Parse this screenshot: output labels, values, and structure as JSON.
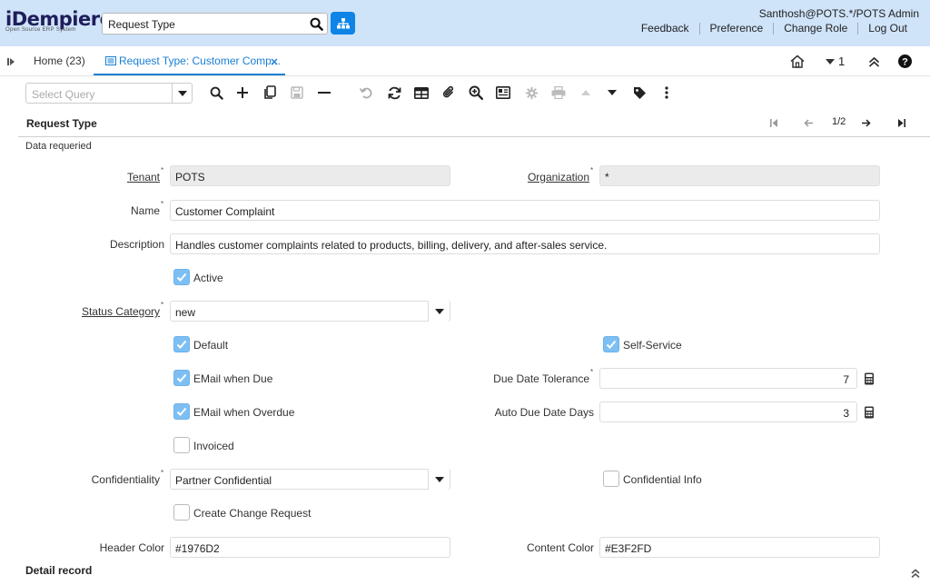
{
  "header": {
    "logo_main": "iDempiere",
    "logo_sub": "Open Source ERP System",
    "search_value": "Request Type",
    "user": "Santhosh@POTS.*/POTS Admin",
    "links": [
      "Feedback",
      "Preference",
      "Change Role",
      "Log Out"
    ]
  },
  "tabs": {
    "home": "Home (23)",
    "active": "Request Type: Customer Comp...",
    "window_count": "1"
  },
  "toolbar": {
    "query_placeholder": "Select Query"
  },
  "panel": {
    "title": "Request Type",
    "record_nav": "1/2",
    "status": "Data requeried"
  },
  "form": {
    "tenant_label": "Tenant",
    "tenant_value": "POTS",
    "organization_label": "Organization",
    "organization_value": "*",
    "name_label": "Name",
    "name_value": "Customer Complaint",
    "description_label": "Description",
    "description_value": "Handles customer complaints related to products, billing, delivery, and after-sales service.",
    "active_label": "Active",
    "status_category_label": "Status Category",
    "status_category_value": "new",
    "default_label": "Default",
    "self_service_label": "Self-Service",
    "email_due_label": "EMail when Due",
    "due_tolerance_label": "Due Date Tolerance",
    "due_tolerance_value": "7",
    "email_overdue_label": "EMail when Overdue",
    "auto_due_label": "Auto Due Date Days",
    "auto_due_value": "3",
    "invoiced_label": "Invoiced",
    "confidentiality_label": "Confidentiality",
    "confidentiality_value": "Partner Confidential",
    "confidential_info_label": "Confidential Info",
    "create_change_label": "Create Change Request",
    "header_color_label": "Header Color",
    "header_color_value": "#1976D2",
    "content_color_label": "Content Color",
    "content_color_value": "#E3F2FD"
  },
  "checkboxes": {
    "active": true,
    "default": true,
    "self_service": true,
    "email_due": true,
    "email_overdue": true,
    "invoiced": false,
    "confidential_info": false,
    "create_change": false
  },
  "footer": {
    "detail_record": "Detail record"
  },
  "colors": {
    "header_bg": "#cfe3f9",
    "accent": "#1a7fd4",
    "checkbox_on": "#7dbff3",
    "tree_button": "#0d84e6"
  }
}
